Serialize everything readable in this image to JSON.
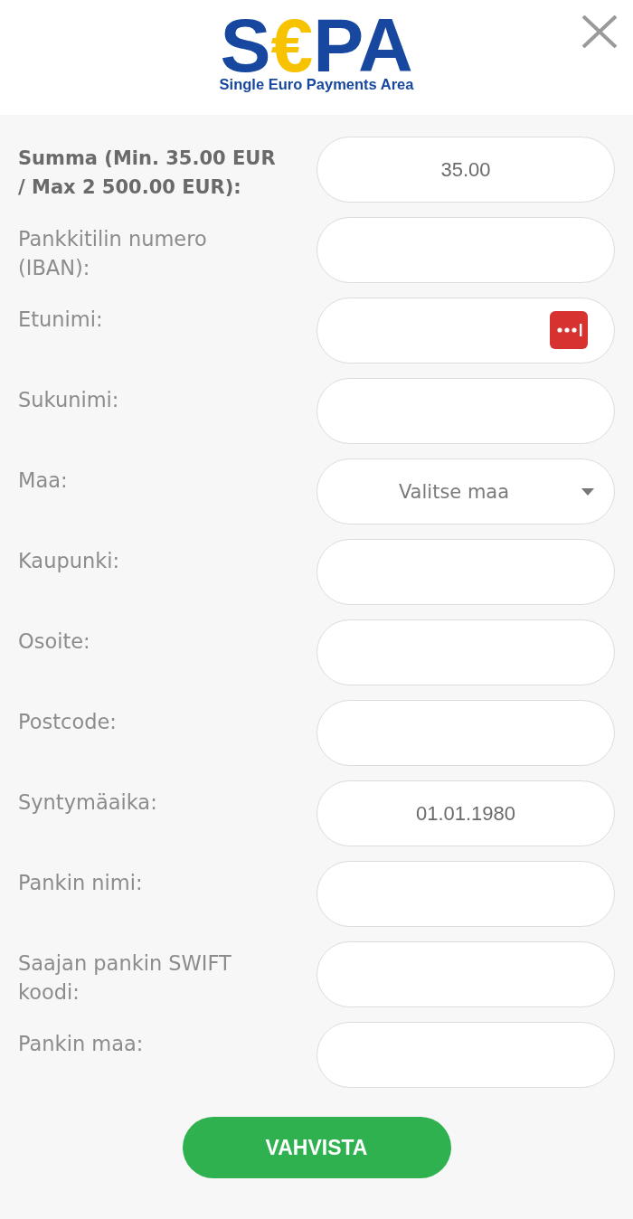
{
  "header": {
    "logo": {
      "wordmark": [
        {
          "text": "S",
          "color": "#17479e"
        },
        {
          "text": "€",
          "color": "#f7c300"
        },
        {
          "text": "PA",
          "color": "#17479e"
        }
      ],
      "tagline": "Single Euro Payments Area"
    }
  },
  "form": {
    "fields": [
      {
        "label": "Summa (Min. 35.00 EUR / Max 2 500.00 EUR):",
        "kind": "text",
        "value": "35.00",
        "emphasis": true,
        "autofill_badge": false
      },
      {
        "label": "Pankkitilin numero (IBAN):",
        "kind": "text",
        "emphasis": false,
        "autofill_badge": false
      },
      {
        "label": "Etunimi:",
        "kind": "text",
        "emphasis": false,
        "autofill_badge": true
      },
      {
        "label": "Sukunimi:",
        "kind": "text",
        "emphasis": false,
        "autofill_badge": false
      },
      {
        "label": "Maa:",
        "kind": "select",
        "value": "Valitse maa",
        "emphasis": false,
        "autofill_badge": false
      },
      {
        "label": "Kaupunki:",
        "kind": "text",
        "emphasis": false,
        "autofill_badge": false
      },
      {
        "label": "Osoite:",
        "kind": "text",
        "emphasis": false,
        "autofill_badge": false
      },
      {
        "label": "Postcode:",
        "kind": "text",
        "emphasis": false,
        "autofill_badge": false
      },
      {
        "label": "Syntymäaika:",
        "kind": "text",
        "value": "01.01.1980",
        "emphasis": false,
        "autofill_badge": false
      },
      {
        "label": "Pankin nimi:",
        "kind": "text",
        "emphasis": false,
        "autofill_badge": false
      },
      {
        "label": "Saajan pankin SWIFT koodi:",
        "kind": "text",
        "emphasis": false,
        "autofill_badge": false
      },
      {
        "label": "Pankin maa:",
        "kind": "text",
        "emphasis": false,
        "autofill_badge": false
      }
    ]
  },
  "submit_button": "VAHVISTA"
}
